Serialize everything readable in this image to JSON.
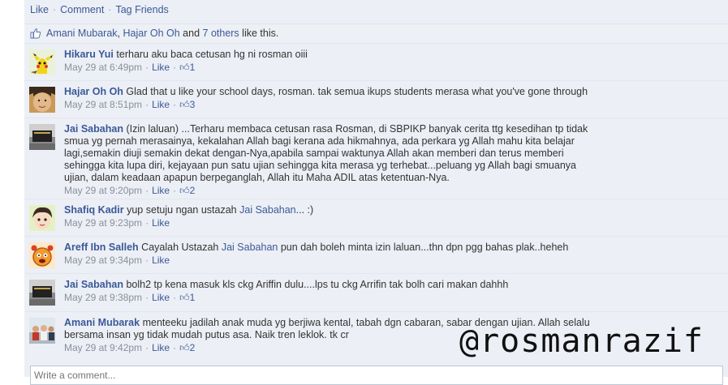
{
  "actions": {
    "like": "Like",
    "comment": "Comment",
    "tag": "Tag Friends",
    "sep": "·"
  },
  "likes": {
    "user1": "Amani Mubarak",
    "comma": ",",
    "user2": "Hajar Oh Oh",
    "and": "and",
    "others": "7 others",
    "suffix": "like this."
  },
  "comments": [
    {
      "author": "Hikaru Yui",
      "text": "terharu aku baca cetusan hg ni rosman oiii",
      "date": "May 29 at 6:49pm",
      "like": "Like",
      "likes": "1"
    },
    {
      "author": "Hajar Oh Oh",
      "text": "Glad that u like your school days, rosman. tak semua ikups students merasa what you've gone through",
      "date": "May 29 at 8:51pm",
      "like": "Like",
      "likes": "3"
    },
    {
      "author": "Jai Sabahan",
      "text": "(Izin laluan) ...Terharu membaca cetusan rasa Rosman, di SBPIKP banyak cerita ttg kesedihan tp tidak smua yg pernah merasainya, kekalahan Allah bagi kerana ada hikmahnya, ada perkara yg Allah mahu kita belajar lagi,semakin diuji semakin dekat dengan-Nya,apabila sampai waktunya Allah akan memberi dan terus memberi sehingga kita lupa diri, kejayaan pun satu ujian sehingga kita merasa yg terhebat...peluang yg Allah bagi smuanya ujian, dalam keadaan apapun berpeganglah, Allah itu Maha ADIL atas ketentuan-Nya.",
      "date": "May 29 at 9:20pm",
      "like": "Like",
      "likes": "2"
    },
    {
      "author": "Shafiq Kadir",
      "text_a": "yup setuju ngan ustazah",
      "mention": "Jai Sabahan",
      "text_b": "... :)",
      "date": "May 29 at 9:23pm",
      "like": "Like"
    },
    {
      "author": "Areff Ibn Salleh",
      "text_a": "Cayalah Ustazah",
      "mention": "Jai Sabahan",
      "text_b": "pun dah boleh minta izin laluan...thn dpn pgg bahas plak..heheh",
      "date": "May 29 at 9:34pm",
      "like": "Like"
    },
    {
      "author": "Jai Sabahan",
      "text": "bolh2 tp kena masuk kls ckg Ariffin dulu....lps tu ckg Arrifin tak bolh cari makan dahhh",
      "date": "May 29 at 9:38pm",
      "like": "Like",
      "likes": "1"
    },
    {
      "author": "Amani Mubarak",
      "text": "menteeku jadilah anak muda yg berjiwa kental, tabah dgn cabaran, sabar dengan ujian. Allah selalu bersama insan yg tidak mudah putus asa. Naik tren leklok. tk cr",
      "date": "May 29 at 9:42pm",
      "like": "Like",
      "likes": "2"
    }
  ],
  "write_placeholder": "Write a comment...",
  "watermark": "@rosmanrazif",
  "colors": {
    "link": "#3b5998",
    "panel": "#eceff5",
    "meta": "#898f9c"
  }
}
